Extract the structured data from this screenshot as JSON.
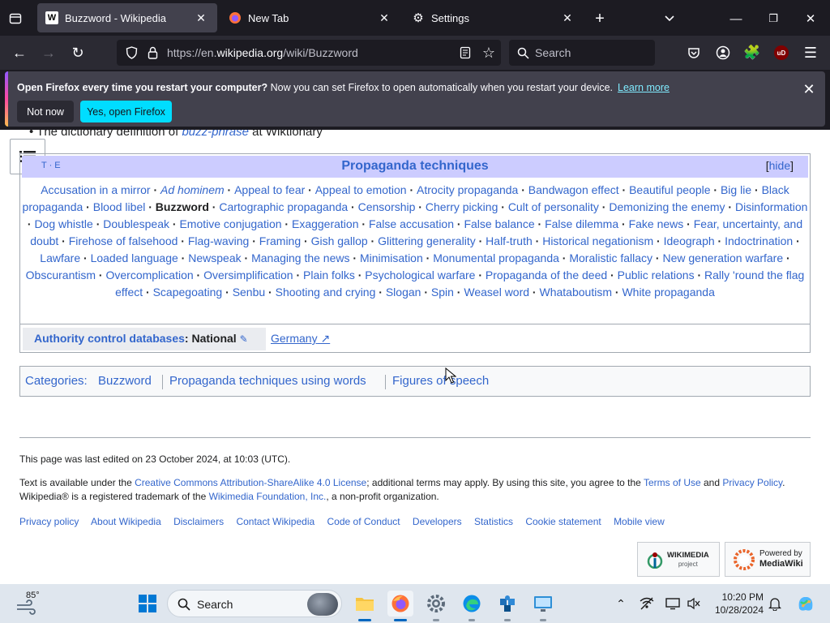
{
  "browser": {
    "tabs": [
      {
        "title": "Buzzword - Wikipedia",
        "icon": "wikipedia-icon",
        "active": true
      },
      {
        "title": "New Tab",
        "icon": "firefox-icon",
        "active": false
      },
      {
        "title": "Settings",
        "icon": "gear-icon",
        "active": false
      }
    ],
    "url_prefix": "https://en.",
    "url_domain": "wikipedia.org",
    "url_path": "/wiki/Buzzword",
    "search_placeholder": "Search",
    "ublock_label": "uD"
  },
  "notice": {
    "bold": "Open Firefox every time you restart your computer?",
    "text": " Now you can set Firefox to open automatically when you restart your device.",
    "link": "Learn more",
    "not_now": "Not now",
    "yes": "Yes, open Firefox"
  },
  "page": {
    "top_line_pre": "The dictionary definition of ",
    "top_line_link": "buzz-phrase",
    "top_line_post": " at Wiktionary",
    "navbox": {
      "vte": "T · E",
      "title": "Propaganda techniques",
      "hide": "hide",
      "items": [
        "Accusation in a mirror",
        "Ad hominem",
        "Appeal to fear",
        "Appeal to emotion",
        "Atrocity propaganda",
        "Bandwagon effect",
        "Beautiful people",
        "Big lie",
        "Black propaganda",
        "Blood libel",
        "Buzzword",
        "Cartographic propaganda",
        "Censorship",
        "Cherry picking",
        "Cult of personality",
        "Demonizing the enemy",
        "Disinformation",
        "Dog whistle",
        "Doublespeak",
        "Emotive conjugation",
        "Exaggeration",
        "False accusation",
        "False balance",
        "False dilemma",
        "Fake news",
        "Fear, uncertainty, and doubt",
        "Firehose of falsehood",
        "Flag-waving",
        "Framing",
        "Gish gallop",
        "Glittering generality",
        "Half-truth",
        "Historical negationism",
        "Ideograph",
        "Indoctrination",
        "Lawfare",
        "Loaded language",
        "Newspeak",
        "Managing the news",
        "Minimisation",
        "Monumental propaganda",
        "Moralistic fallacy",
        "New generation warfare",
        "Obscurantism",
        "Overcomplication",
        "Oversimplification",
        "Plain folks",
        "Psychological warfare",
        "Propaganda of the deed",
        "Public relations",
        "Rally 'round the flag effect",
        "Scapegoating",
        "Senbu",
        "Shooting and crying",
        "Slogan",
        "Spin",
        "Weasel word",
        "Whataboutism",
        "White propaganda"
      ],
      "current": "Buzzword"
    },
    "authority": {
      "label": "Authority control databases",
      "label_bold": ": National",
      "value": "Germany"
    },
    "categories": {
      "label": "Categories:",
      "items": [
        "Buzzword",
        "Propaganda techniques using words",
        "Figures of speech"
      ]
    },
    "footer": {
      "last_edited": "This page was last edited on 23 October 2024, at 10:03 (UTC).",
      "license_pre": "Text is available under the ",
      "license_link": "Creative Commons Attribution-ShareAlike 4.0 License",
      "license_mid": "; additional terms may apply. By using this site, you agree to the ",
      "terms": "Terms of Use",
      "and": " and ",
      "privacy": "Privacy Policy",
      "trademark_pre": "Wikipedia® is a registered trademark of the ",
      "trademark_link": "Wikimedia Foundation, Inc.",
      "trademark_post": ", a non-profit organization.",
      "links": [
        "Privacy policy",
        "About Wikipedia",
        "Disclaimers",
        "Contact Wikipedia",
        "Code of Conduct",
        "Developers",
        "Statistics",
        "Cookie statement",
        "Mobile view"
      ],
      "wikimedia_badge": "WIKIMEDIA",
      "wikimedia_sub": "project",
      "mediawiki_badge_top": "Powered by",
      "mediawiki_badge_bottom": "MediaWiki"
    }
  },
  "taskbar": {
    "weather_temp": "85°",
    "search_placeholder": "Search",
    "time": "10:20 PM",
    "date": "10/28/2024"
  },
  "colors": {
    "link": "#3366cc",
    "navbox_title_bg": "#ccccff",
    "notice_button": "#00ddff"
  }
}
